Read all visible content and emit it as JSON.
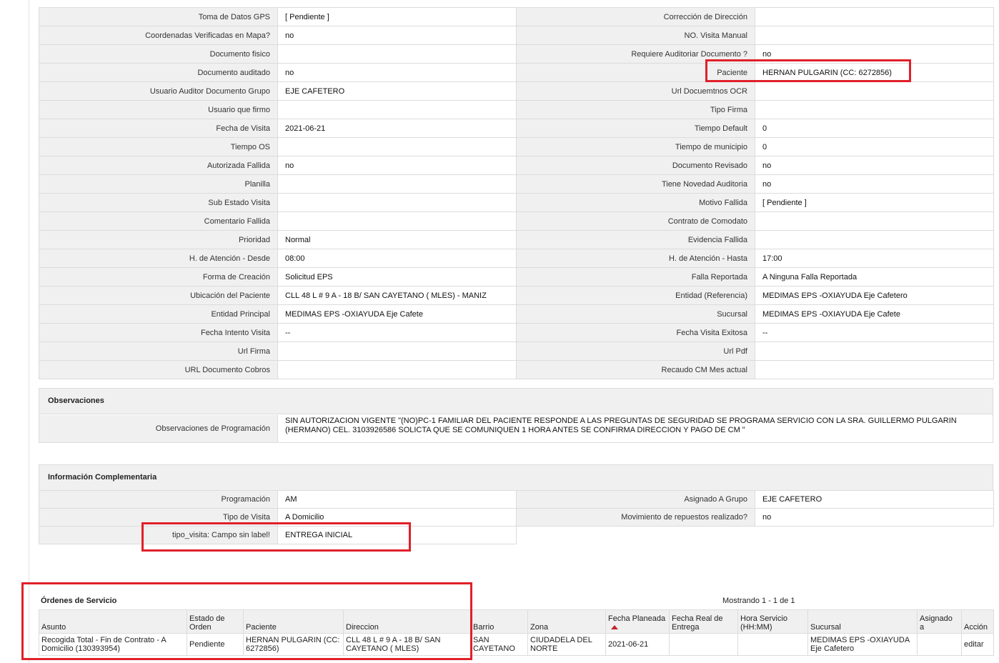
{
  "detail_rows": [
    {
      "l1": "Toma de Datos GPS",
      "v1": "[ Pendiente ]",
      "l2": "Corrección de Dirección",
      "v2": ""
    },
    {
      "l1": "Coordenadas Verificadas en Mapa?",
      "v1": "no",
      "l2": "NO. Visita Manual",
      "v2": ""
    },
    {
      "l1": "Documento fisico",
      "v1": "",
      "l2": "Requiere Auditoriar Documento ?",
      "v2": "no"
    },
    {
      "l1": "Documento auditado",
      "v1": "no",
      "l2": "Paciente",
      "v2": "HERNAN PULGARIN (CC: 6272856)"
    },
    {
      "l1": "Usuario Auditor Documento Grupo",
      "v1": "EJE CAFETERO",
      "l2": "Url Docuemtnos OCR",
      "v2": ""
    },
    {
      "l1": "Usuario que firmo",
      "v1": "",
      "l2": "Tipo Firma",
      "v2": ""
    },
    {
      "l1": "Fecha de Visita",
      "v1": "2021-06-21",
      "l2": "Tiempo Default",
      "v2": "0"
    },
    {
      "l1": "Tiempo OS",
      "v1": "",
      "l2": "Tiempo de municipio",
      "v2": "0"
    },
    {
      "l1": "Autorizada Fallida",
      "v1": "no",
      "l2": "Documento Revisado",
      "v2": "no"
    },
    {
      "l1": "Planilla",
      "v1": "",
      "l2": "Tiene Novedad Auditoria",
      "v2": "no"
    },
    {
      "l1": "Sub Estado Visita",
      "v1": "",
      "l2": "Motivo Fallida",
      "v2": "[ Pendiente ]"
    },
    {
      "l1": "Comentario Fallida",
      "v1": "",
      "l2": "Contrato de Comodato",
      "v2": ""
    },
    {
      "l1": "Prioridad",
      "v1": "Normal",
      "l2": "Evidencia Fallida",
      "v2": ""
    },
    {
      "l1": "H. de Atención - Desde",
      "v1": "08:00",
      "l2": "H. de Atención - Hasta",
      "v2": "17:00"
    },
    {
      "l1": "Forma de Creación",
      "v1": "Solicitud EPS",
      "l2": "Falla Reportada",
      "v2": "A Ninguna Falla Reportada"
    },
    {
      "l1": "Ubicación del Paciente",
      "v1": "CLL 48 L # 9 A - 18 B/ SAN CAYETANO ( MLES) - MANIZ",
      "l2": "Entidad (Referencia)",
      "v2": "MEDIMAS EPS -OXIAYUDA Eje Cafetero"
    },
    {
      "l1": "Entidad Principal",
      "v1": "MEDIMAS EPS -OXIAYUDA Eje Cafete",
      "l2": "Sucursal",
      "v2": "MEDIMAS EPS -OXIAYUDA Eje Cafete"
    },
    {
      "l1": "Fecha Intento Visita",
      "v1": "--",
      "l2": "Fecha Visita Exitosa",
      "v2": "--"
    },
    {
      "l1": "Url Firma",
      "v1": "",
      "l2": "Url Pdf",
      "v2": ""
    },
    {
      "l1": "URL Documento Cobros",
      "v1": "",
      "l2": "Recaudo CM Mes actual",
      "v2": ""
    }
  ],
  "observaciones": {
    "title": "Observaciones",
    "label": "Observaciones de Programación",
    "text": "  SIN AUTORIZACION VIGENTE \"(NO)PC-1 FAMILIAR DEL PACIENTE RESPONDE A LAS PREGUNTAS DE SEGURIDAD SE PROGRAMA SERVICIO CON LA SRA. GUILLERMO PULGARIN (HERMANO) CEL. 3103926586 SOLICTA QUE SE COMUNIQUEN 1 HORA ANTES SE CONFIRMA DIRECCION Y PAGO DE CM \""
  },
  "info": {
    "title": "Información Complementaria",
    "rows": [
      {
        "l1": "Programación",
        "v1": "AM",
        "l2": "Asignado A Grupo",
        "v2": "EJE CAFETERO"
      },
      {
        "l1": "Tipo de Visita",
        "v1": "A Domicilio",
        "l2": "Movimiento de repuestos realizado?",
        "v2": "no"
      }
    ],
    "extra": {
      "label": "tipo_visita: Campo sin label!",
      "value": "ENTREGA INICIAL"
    }
  },
  "orders": {
    "title": "Órdenes de Servicio",
    "showing": "Mostrando 1 - 1 de 1",
    "headers": [
      "Asunto",
      "Estado de Orden",
      "Paciente",
      "Direccion",
      "Barrio",
      "Zona",
      "Fecha Planeada",
      "Fecha Real de Entrega",
      "Hora Servicio (HH:MM)",
      "Sucursal",
      "Asignado a",
      "Acción"
    ],
    "row": {
      "asunto": "Recogida Total - Fin de Contrato - A Domicilio (130393954)",
      "estado": "Pendiente",
      "paciente": "HERNAN PULGARIN (CC: 6272856)",
      "direccion": "CLL 48 L # 9 A - 18 B/ SAN CAYETANO ( MLES)",
      "barrio": "SAN CAYETANO",
      "zona": "CIUDADELA DEL NORTE",
      "fecha_planeada": "2021-06-21",
      "fecha_real": "",
      "hora": "",
      "sucursal": "MEDIMAS EPS -OXIAYUDA Eje Cafetero",
      "asignado": "",
      "accion": "editar"
    }
  },
  "colors": {
    "highlight": "#e0202a",
    "label_bg": "#f0f0f0",
    "border": "#dcdcdc",
    "sort_arrow": "#c0272d"
  }
}
